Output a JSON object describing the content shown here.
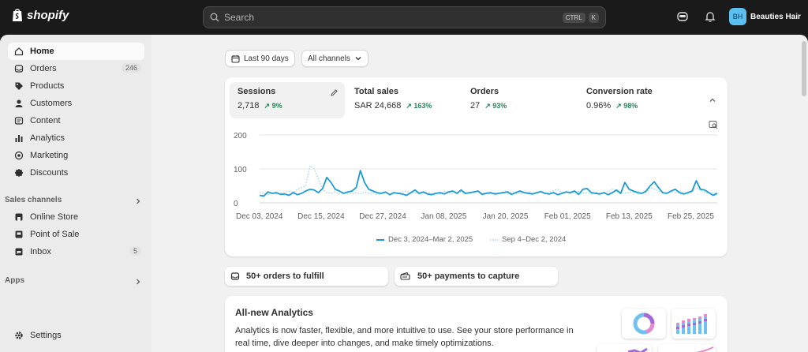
{
  "topbar": {
    "logo_text": "shopify",
    "search_placeholder": "Search",
    "shortcut_keys": [
      "CTRL",
      "K"
    ],
    "store_initials": "BH",
    "store_name": "Beauties Hair",
    "icons": [
      "shopify-bag-icon",
      "search-icon",
      "sidekick-icon",
      "bell-icon"
    ]
  },
  "sidebar": {
    "items": [
      {
        "label": "Home",
        "icon": "home-icon",
        "active": true
      },
      {
        "label": "Orders",
        "icon": "orders-icon",
        "badge": "246"
      },
      {
        "label": "Products",
        "icon": "tag-icon"
      },
      {
        "label": "Customers",
        "icon": "person-icon"
      },
      {
        "label": "Content",
        "icon": "content-icon"
      },
      {
        "label": "Analytics",
        "icon": "bar-chart-icon"
      },
      {
        "label": "Marketing",
        "icon": "target-icon"
      },
      {
        "label": "Discounts",
        "icon": "discount-icon"
      }
    ],
    "sales_channels_title": "Sales channels",
    "channels": [
      {
        "label": "Online Store",
        "icon": "store-icon"
      },
      {
        "label": "Point of Sale",
        "icon": "pos-icon"
      },
      {
        "label": "Inbox",
        "icon": "inbox-icon",
        "badge": "5"
      }
    ],
    "apps_title": "Apps",
    "settings_label": "Settings"
  },
  "filters": {
    "date_range": "Last 90 days",
    "channels": "All channels"
  },
  "metrics": [
    {
      "label": "Sessions",
      "value": "2,718",
      "delta": "9%",
      "active": true
    },
    {
      "label": "Total sales",
      "value": "SAR 24,668",
      "delta": "163%"
    },
    {
      "label": "Orders",
      "value": "27",
      "delta": "93%"
    },
    {
      "label": "Conversion rate",
      "value": "0.96%",
      "delta": "98%"
    }
  ],
  "chart_data": {
    "type": "line",
    "ylim": [
      0,
      200
    ],
    "yticks": [
      "200",
      "100",
      "0"
    ],
    "xticks": [
      "Dec 03, 2024",
      "Dec 15, 2024",
      "Dec 27, 2024",
      "Jan 08, 2025",
      "Jan 20, 2025",
      "Feb 01, 2025",
      "Feb 13, 2025",
      "Feb 25, 2025"
    ],
    "series": [
      {
        "name": "Dec 3, 2024–Mar 2, 2025",
        "style": "solid",
        "color": "#1c9ad6",
        "values": [
          22,
          20,
          32,
          28,
          30,
          25,
          26,
          22,
          30,
          24,
          28,
          35,
          40,
          38,
          30,
          42,
          75,
          60,
          40,
          35,
          28,
          32,
          35,
          45,
          95,
          60,
          40,
          35,
          30,
          28,
          32,
          24,
          30,
          28,
          26,
          22,
          30,
          38,
          28,
          32,
          26,
          24,
          28,
          30,
          26,
          32,
          35,
          28,
          38,
          28,
          30,
          32,
          35,
          25,
          28,
          30,
          26,
          28,
          30,
          32,
          25,
          30,
          35,
          30,
          28,
          26,
          30,
          33,
          28,
          26,
          30,
          24,
          28,
          32,
          30,
          35,
          25,
          40,
          42,
          30,
          28,
          26,
          30,
          24,
          30,
          38,
          28,
          60,
          40,
          35,
          30,
          28,
          34,
          50,
          62,
          45,
          30,
          28,
          35,
          40,
          30,
          26,
          30,
          35,
          65,
          40,
          38,
          30,
          22,
          28
        ]
      },
      {
        "name": "Sep 4–Dec 2, 2024",
        "style": "dotted",
        "color": "#9fd7f0",
        "values": [
          30,
          28,
          25,
          30,
          26,
          28,
          32,
          35,
          30,
          40,
          45,
          50,
          110,
          100,
          70,
          40,
          30,
          28,
          32,
          26,
          30,
          28,
          26,
          30,
          26,
          32,
          28,
          30,
          24,
          28,
          30,
          26,
          30,
          28,
          32,
          35,
          28,
          30,
          26,
          30,
          32,
          28,
          30,
          26,
          34,
          30,
          28,
          30,
          32,
          26,
          28,
          30,
          35,
          28,
          30,
          26,
          30,
          28,
          32,
          34,
          30,
          28,
          26,
          30,
          32,
          28,
          30,
          34,
          28,
          30,
          35,
          40,
          30,
          32,
          28,
          30,
          34,
          28,
          30,
          26,
          32,
          28,
          30,
          34,
          40,
          35,
          30,
          28,
          32,
          30,
          36,
          28,
          30,
          45,
          40,
          35,
          30,
          28,
          32,
          30,
          35,
          30,
          28,
          32,
          45,
          38,
          30,
          28,
          30,
          26
        ]
      }
    ]
  },
  "actions": [
    {
      "label": "50+ orders to fulfill",
      "icon": "inbox-tray-icon"
    },
    {
      "label": "50+ payments to capture",
      "icon": "credit-card-icon"
    }
  ],
  "promo": {
    "title": "All-new Analytics",
    "body": "Analytics is now faster, flexible, and more intuitive to use. See your store performance in real time, dive deeper into changes, and make timely optimizations."
  }
}
